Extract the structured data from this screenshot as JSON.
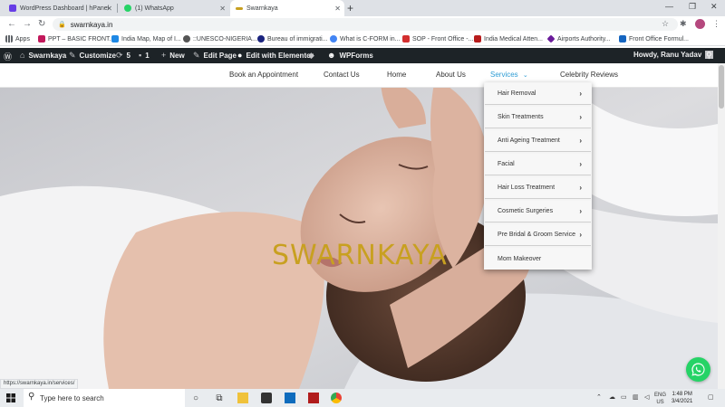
{
  "browser": {
    "tabs": [
      {
        "title": "WordPress Dashboard | hPanel",
        "icon": "hpanel-icon",
        "color": "#673de6"
      },
      {
        "title": "(1) WhatsApp",
        "icon": "whatsapp-icon",
        "color": "#25d366"
      },
      {
        "title": "Swarnkaya",
        "icon": "swarnkaya-icon",
        "color": "#c8a020"
      }
    ],
    "url": "swarnkaya.in",
    "bookmarks": [
      {
        "label": "Apps",
        "icon": "apps-grid-icon",
        "color": "#5f6368"
      },
      {
        "label": "PPT – BASIC FRONT...",
        "icon": "bookmark-ppt-icon",
        "color": "#c2185b"
      },
      {
        "label": "India Map, Map of I...",
        "icon": "bookmark-map-icon",
        "color": "#1e88e5"
      },
      {
        "label": "::UNESCO-NIGERIA...",
        "icon": "bookmark-unesco-icon",
        "color": "#555555"
      },
      {
        "label": "Bureau of immigrati...",
        "icon": "bookmark-boi-icon",
        "color": "#1a237e"
      },
      {
        "label": "What is C-FORM in...",
        "icon": "bookmark-cform-icon",
        "color": "#4285f4"
      },
      {
        "label": "SOP - Front Office -...",
        "icon": "bookmark-sop-icon",
        "color": "#d32f2f"
      },
      {
        "label": "India Medical Atten...",
        "icon": "bookmark-medical-icon",
        "color": "#b71c1c"
      },
      {
        "label": "Airports Authority...",
        "icon": "bookmark-airport-icon",
        "color": "#6a1b9a"
      },
      {
        "label": "Front Office Formul...",
        "icon": "bookmark-formula-icon",
        "color": "#1565c0"
      }
    ],
    "status_url": "https://swarnkaya.in/services/"
  },
  "wp_admin": {
    "site": "Swarnkaya",
    "customize": "Customize",
    "updates": "5",
    "comments": "1",
    "new": "New",
    "edit_page": "Edit Page",
    "elementor": "Edit with Elementor",
    "wpforms": "WPForms",
    "howdy": "Howdy, Ranu Yadav"
  },
  "site": {
    "nav": [
      {
        "label": "Book an Appointment"
      },
      {
        "label": "Contact Us"
      },
      {
        "label": "Home"
      },
      {
        "label": "About Us"
      },
      {
        "label": "Services",
        "active": true
      },
      {
        "label": "Celebrity Reviews"
      }
    ],
    "hero_title": "SWARNKAYA",
    "accent": "#2e9cd4",
    "title_color": "#c8a020"
  },
  "services_menu": [
    {
      "label": "Hair Removal",
      "has_sub": true
    },
    {
      "label": "Skin Treatments",
      "has_sub": true
    },
    {
      "label": "Anti Ageing Treatment",
      "has_sub": true
    },
    {
      "label": "Facial",
      "has_sub": true
    },
    {
      "label": "Hair Loss Treatment",
      "has_sub": true
    },
    {
      "label": "Cosmetic Surgeries",
      "has_sub": true
    },
    {
      "label": "Pre Bridal & Groom Service",
      "has_sub": true
    },
    {
      "label": "Mom Makeover",
      "has_sub": false
    }
  ],
  "taskbar": {
    "search_placeholder": "Type here to search",
    "lang": "ENG",
    "region": "US",
    "time": "1:48 PM",
    "date": "3/4/2021"
  }
}
